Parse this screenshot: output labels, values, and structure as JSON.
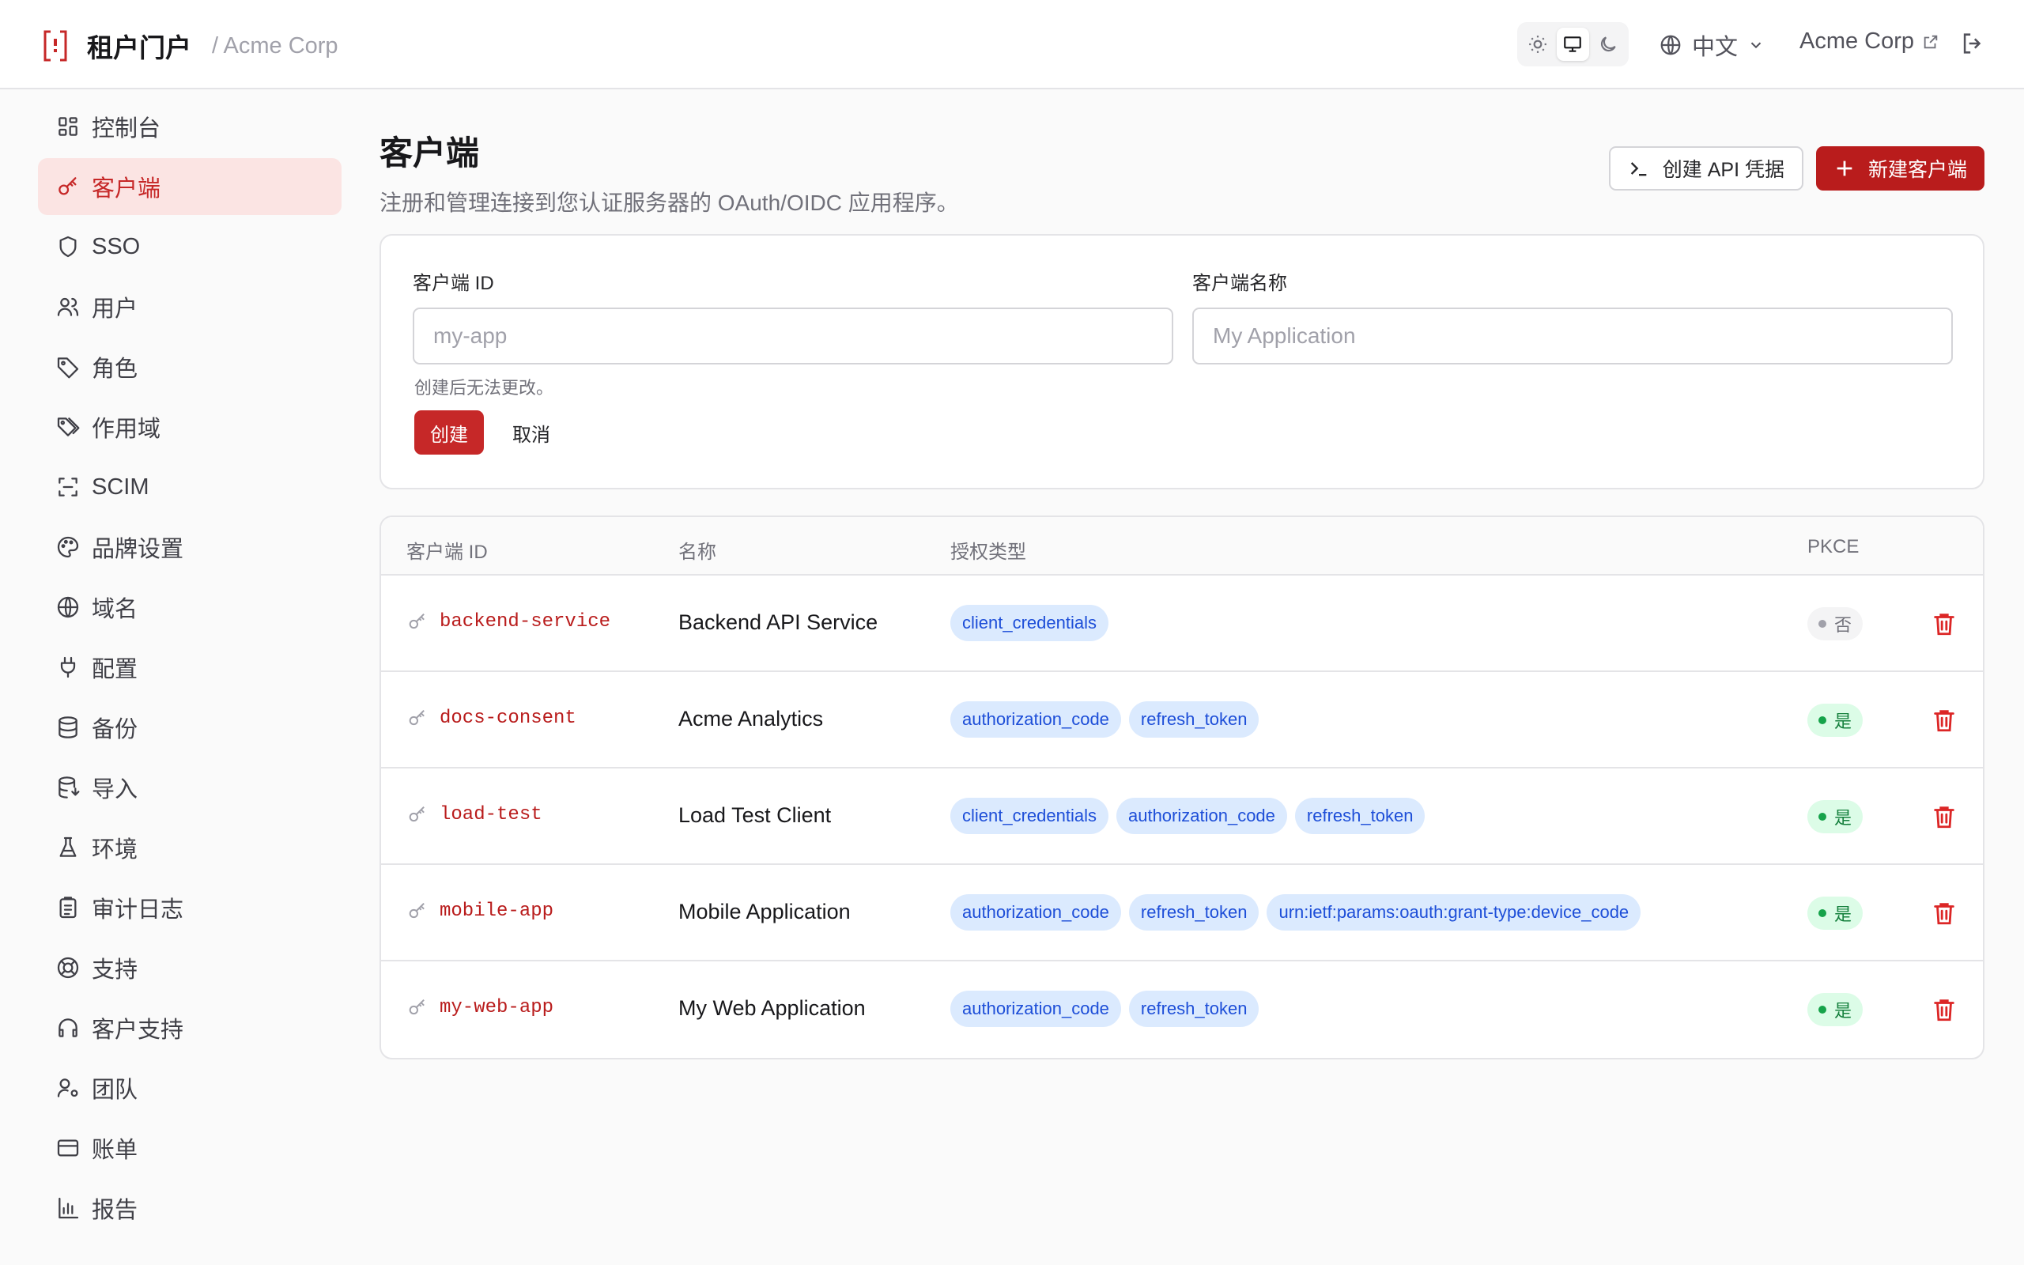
{
  "header": {
    "app_title": "租户门户",
    "org_crumb": "/ Acme Corp",
    "language": "中文",
    "org_name": "Acme Corp",
    "theme_options": [
      "sun-icon",
      "monitor-icon",
      "moon-icon"
    ],
    "active_theme": "monitor"
  },
  "sidebar": {
    "items": [
      {
        "label": "控制台",
        "icon": "dashboard-icon"
      },
      {
        "label": "客户端",
        "icon": "key-icon",
        "active": true
      },
      {
        "label": "SSO",
        "icon": "shield-icon"
      },
      {
        "label": "用户",
        "icon": "users-icon"
      },
      {
        "label": "角色",
        "icon": "tag-icon"
      },
      {
        "label": "作用域",
        "icon": "tags-icon"
      },
      {
        "label": "SCIM",
        "icon": "scan-icon"
      },
      {
        "label": "品牌设置",
        "icon": "palette-icon"
      },
      {
        "label": "域名",
        "icon": "globe-icon"
      },
      {
        "label": "配置",
        "icon": "plug-icon"
      },
      {
        "label": "备份",
        "icon": "database-icon"
      },
      {
        "label": "导入",
        "icon": "database-import-icon"
      },
      {
        "label": "环境",
        "icon": "flask-icon"
      },
      {
        "label": "审计日志",
        "icon": "clipboard-icon"
      },
      {
        "label": "支持",
        "icon": "lifebuoy-icon"
      },
      {
        "label": "客户支持",
        "icon": "headset-icon"
      },
      {
        "label": "团队",
        "icon": "user-cog-icon"
      },
      {
        "label": "账单",
        "icon": "credit-card-icon"
      },
      {
        "label": "报告",
        "icon": "bar-chart-icon"
      }
    ]
  },
  "page": {
    "title": "客户端",
    "subtitle": "注册和管理连接到您认证服务器的 OAuth/OIDC 应用程序。",
    "create_api_label": "创建 API 凭据",
    "new_client_label": "新建客户端"
  },
  "form": {
    "client_id_label": "客户端 ID",
    "client_id_placeholder": "my-app",
    "client_name_label": "客户端名称",
    "client_name_placeholder": "My Application",
    "hint": "创建后无法更改。",
    "create_label": "创建",
    "cancel_label": "取消"
  },
  "table": {
    "headers": {
      "id": "客户端 ID",
      "name": "名称",
      "grants": "授权类型",
      "pkce": "PKCE"
    },
    "rows": [
      {
        "id": "backend-service",
        "name": "Backend API Service",
        "grants": [
          "client_credentials"
        ],
        "pkce": "否",
        "pkce_on": false
      },
      {
        "id": "docs-consent",
        "name": "Acme Analytics",
        "grants": [
          "authorization_code",
          "refresh_token"
        ],
        "pkce": "是",
        "pkce_on": true
      },
      {
        "id": "load-test",
        "name": "Load Test Client",
        "grants": [
          "client_credentials",
          "authorization_code",
          "refresh_token"
        ],
        "pkce": "是",
        "pkce_on": true
      },
      {
        "id": "mobile-app",
        "name": "Mobile Application",
        "grants": [
          "authorization_code",
          "refresh_token",
          "urn:ietf:params:oauth:grant-type:device_code"
        ],
        "pkce": "是",
        "pkce_on": true
      },
      {
        "id": "my-web-app",
        "name": "My Web Application",
        "grants": [
          "authorization_code",
          "refresh_token"
        ],
        "pkce": "是",
        "pkce_on": true
      }
    ]
  },
  "colors": {
    "accent": "#c62828",
    "chip_bg": "#dbeafe",
    "chip_text": "#1d4ed8",
    "pkce_yes": "#16a34a"
  }
}
